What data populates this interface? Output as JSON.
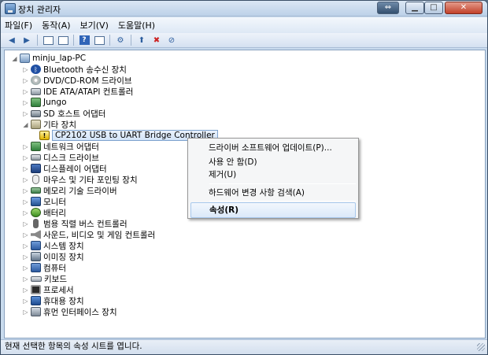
{
  "window": {
    "title": "장치 관리자"
  },
  "menu": [
    "파일(F)",
    "동작(A)",
    "보기(V)",
    "도움말(H)"
  ],
  "tree": {
    "root": "minju_lap-PC",
    "items": [
      {
        "label": "Bluetooth 송수신 장치",
        "icon": "bluetooth-icon"
      },
      {
        "label": "DVD/CD-ROM 드라이브",
        "icon": "disc-drive-icon"
      },
      {
        "label": "IDE ATA/ATAPI 컨트롤러",
        "icon": "ide-controller-icon"
      },
      {
        "label": "Jungo",
        "icon": "jungo-icon"
      },
      {
        "label": "SD 호스트 어댑터",
        "icon": "sd-host-icon"
      },
      {
        "label": "기타 장치",
        "icon": "other-devices-icon"
      },
      {
        "label": "CP2102 USB to UART Bridge Controller",
        "icon": "warning-device-icon"
      },
      {
        "label": "네트워크 어댑터",
        "icon": "network-adapter-icon"
      },
      {
        "label": "디스크 드라이브",
        "icon": "disk-drive-icon"
      },
      {
        "label": "디스플레이 어댑터",
        "icon": "display-adapter-icon"
      },
      {
        "label": "마우스 및 기타 포인팅 장치",
        "icon": "mouse-icon"
      },
      {
        "label": "메모리 기술 드라이버",
        "icon": "memory-icon"
      },
      {
        "label": "모니터",
        "icon": "monitor-icon"
      },
      {
        "label": "배터리",
        "icon": "battery-icon"
      },
      {
        "label": "범용 직렬 버스 컨트롤러",
        "icon": "usb-controller-icon"
      },
      {
        "label": "사운드, 비디오 및 게임 컨트롤러",
        "icon": "sound-icon"
      },
      {
        "label": "시스템 장치",
        "icon": "system-device-icon"
      },
      {
        "label": "이미징 장치",
        "icon": "imaging-device-icon"
      },
      {
        "label": "컴퓨터",
        "icon": "computer-icon"
      },
      {
        "label": "키보드",
        "icon": "keyboard-icon"
      },
      {
        "label": "프로세서",
        "icon": "processor-icon"
      },
      {
        "label": "휴대용 장치",
        "icon": "portable-device-icon"
      },
      {
        "label": "휴먼 인터페이스 장치",
        "icon": "hid-icon"
      }
    ]
  },
  "context_menu": {
    "update": "드라이버 소프트웨어 업데이트(P)...",
    "disable": "사용 안 함(D)",
    "uninstall": "제거(U)",
    "scan": "하드웨어 변경 사항 검색(A)",
    "properties": "속성(R)"
  },
  "status": "현재 선택한 항목의 속성 시트를 엽니다."
}
